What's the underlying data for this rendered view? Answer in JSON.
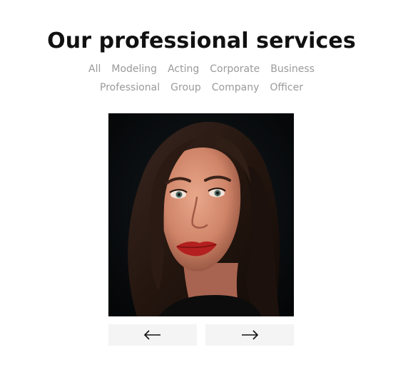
{
  "section": {
    "title": "Our professional services"
  },
  "filters": {
    "row1": [
      "All",
      "Modeling",
      "Acting",
      "Corporate",
      "Business"
    ],
    "row2": [
      "Professional",
      "Group",
      "Company",
      "Officer"
    ]
  },
  "gallery": {
    "image": "portrait-photo"
  },
  "navigation": {
    "prev_icon": "arrow-left-icon",
    "next_icon": "arrow-right-icon"
  },
  "colors": {
    "title": "#111111",
    "filter": "#9a9a9a",
    "button_bg": "#f4f4f4"
  }
}
